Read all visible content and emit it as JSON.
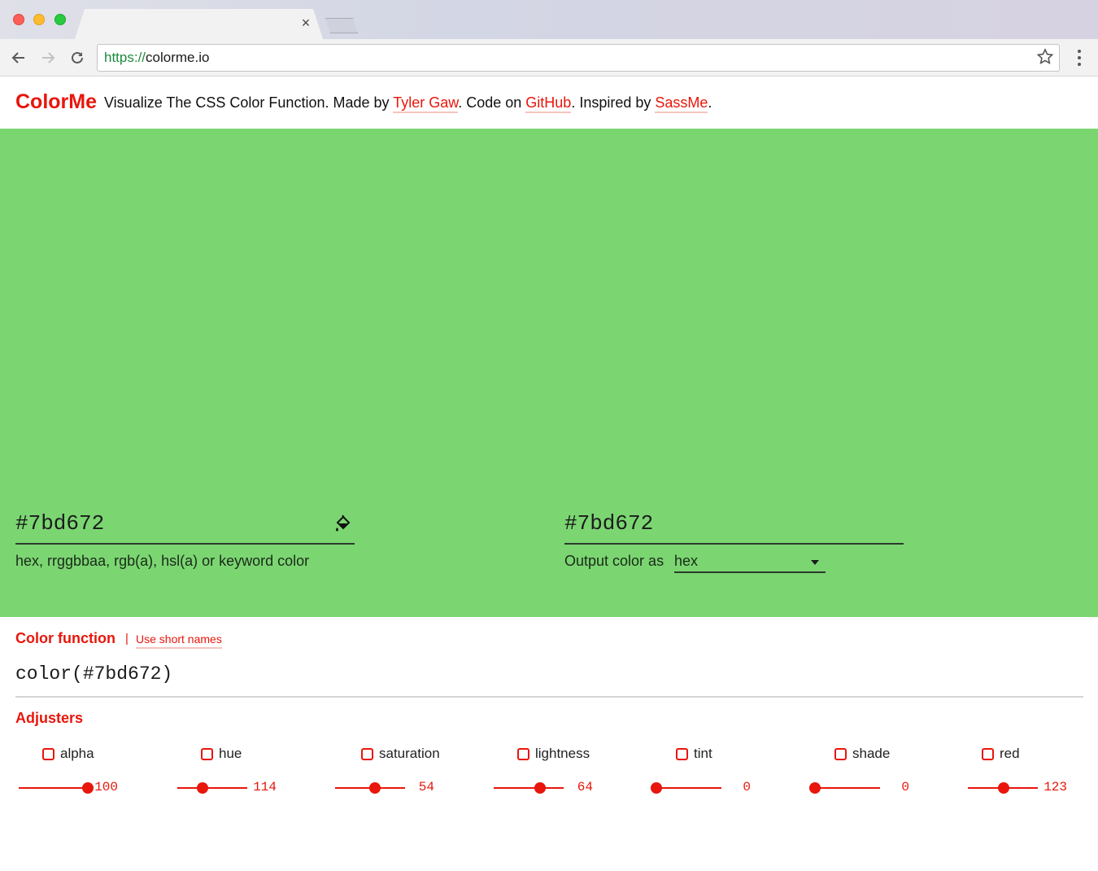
{
  "browser": {
    "tab_close": "×",
    "url_scheme": "https://",
    "url_host": "colorme.io"
  },
  "header": {
    "logo": "ColorMe",
    "text1": "Visualize The CSS Color Function. Made by ",
    "author_link": "Tyler Gaw",
    "text2": ". Code on ",
    "github_link": "GitHub",
    "text3": ". Inspired by ",
    "inspired_link": "SassMe",
    "text4": "."
  },
  "swatch": {
    "color": "#7bd672",
    "input_value": "#7bd672",
    "input_hint": "hex, rrggbbaa, rgb(a), hsl(a) or keyword color",
    "output_value": "#7bd672",
    "output_label": "Output color as",
    "output_format": "hex"
  },
  "color_function": {
    "title": "Color function",
    "separator": "|",
    "short_names_link": "Use short names",
    "output": "color(#7bd672)"
  },
  "adjusters": {
    "title": "Adjusters",
    "items": [
      {
        "label": "alpha",
        "value": "100",
        "fraction": 1.0
      },
      {
        "label": "hue",
        "value": "114",
        "fraction": 0.317
      },
      {
        "label": "saturation",
        "value": "54",
        "fraction": 0.54
      },
      {
        "label": "lightness",
        "value": "64",
        "fraction": 0.64
      },
      {
        "label": "tint",
        "value": "0",
        "fraction": 0.0
      },
      {
        "label": "shade",
        "value": "0",
        "fraction": 0.0
      },
      {
        "label": "red",
        "value": "123",
        "fraction": 0.482
      }
    ]
  },
  "colors": {
    "accent": "#e8160c",
    "swatch": "#7bd672"
  }
}
